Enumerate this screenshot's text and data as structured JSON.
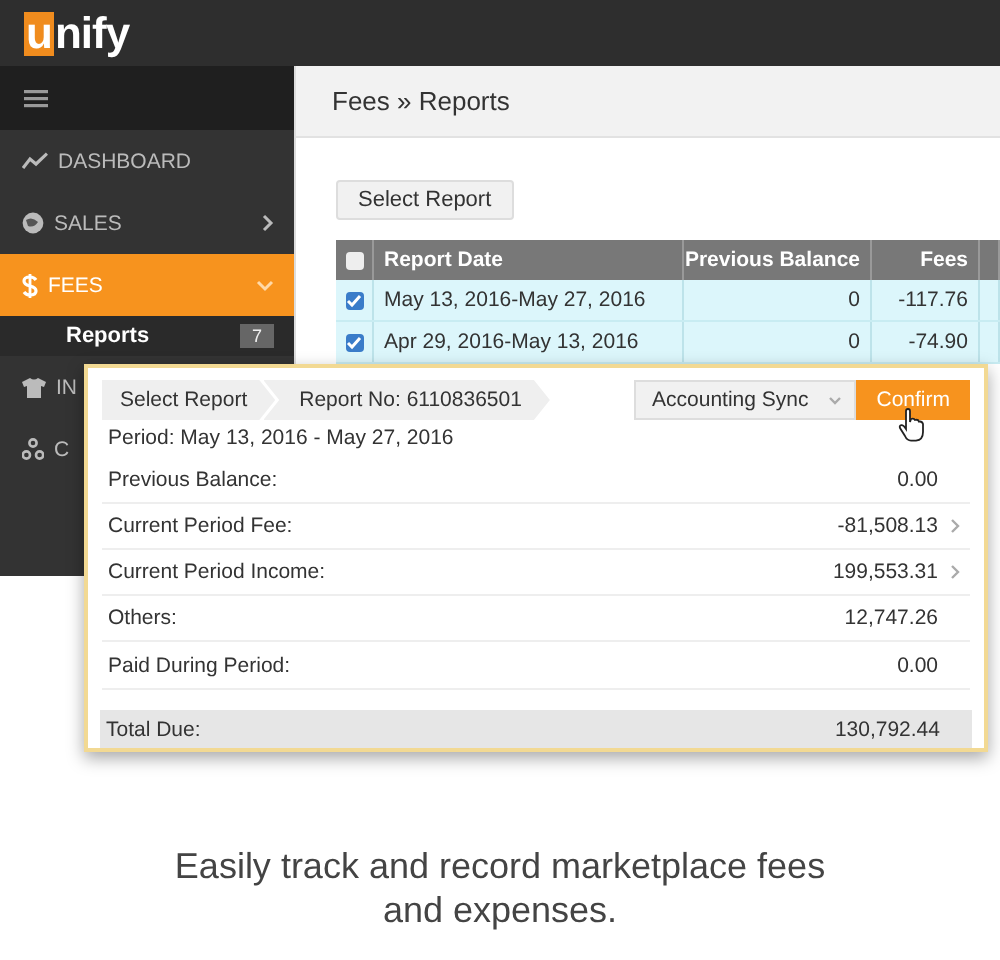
{
  "app": {
    "logo_mark": "u",
    "logo_text": "nify"
  },
  "sidebar": {
    "items": [
      {
        "label": "DASHBOARD",
        "selected": false
      },
      {
        "label": "SALES",
        "selected": false,
        "expanded": false
      },
      {
        "label": "FEES",
        "selected": true,
        "expanded": true,
        "children": [
          {
            "label": "Reports",
            "badge": "7"
          }
        ]
      },
      {
        "label": "IN",
        "selected": false
      },
      {
        "label": "C",
        "selected": false
      }
    ]
  },
  "header": {
    "breadcrumb": "Fees » Reports"
  },
  "select_button": "Select Report",
  "table": {
    "all_checked": false,
    "columns": [
      "Report Date",
      "Previous Balance",
      "Fees"
    ],
    "rows": [
      {
        "checked": true,
        "cells": [
          "May 13, 2016-May 27, 2016",
          "0",
          "-117.76"
        ]
      },
      {
        "checked": true,
        "cells": [
          "Apr 29, 2016-May 13, 2016",
          "0",
          "-74.90"
        ]
      }
    ]
  },
  "dialog": {
    "steps": [
      "Select Report",
      "Report No: 6110836501"
    ],
    "sync": "Accounting Sync",
    "confirm": "Confirm",
    "period": "Period: May 13, 2016 - May 27, 2016",
    "lines": [
      {
        "label": "Previous Balance:",
        "value": "0.00",
        "link": false
      },
      {
        "label": "Current Period Fee:",
        "value": "-81,508.13",
        "link": true
      },
      {
        "label": "Current Period Income:",
        "value": "199,553.31",
        "link": true
      },
      {
        "label": "Others:",
        "value": "12,747.26",
        "link": false
      },
      {
        "label": "Paid During Period:",
        "value": "0.00",
        "link": false
      }
    ],
    "total": {
      "label": "Total Due:",
      "value": "130,792.44"
    }
  },
  "caption": "Easily track and record marketplace fees and expenses."
}
